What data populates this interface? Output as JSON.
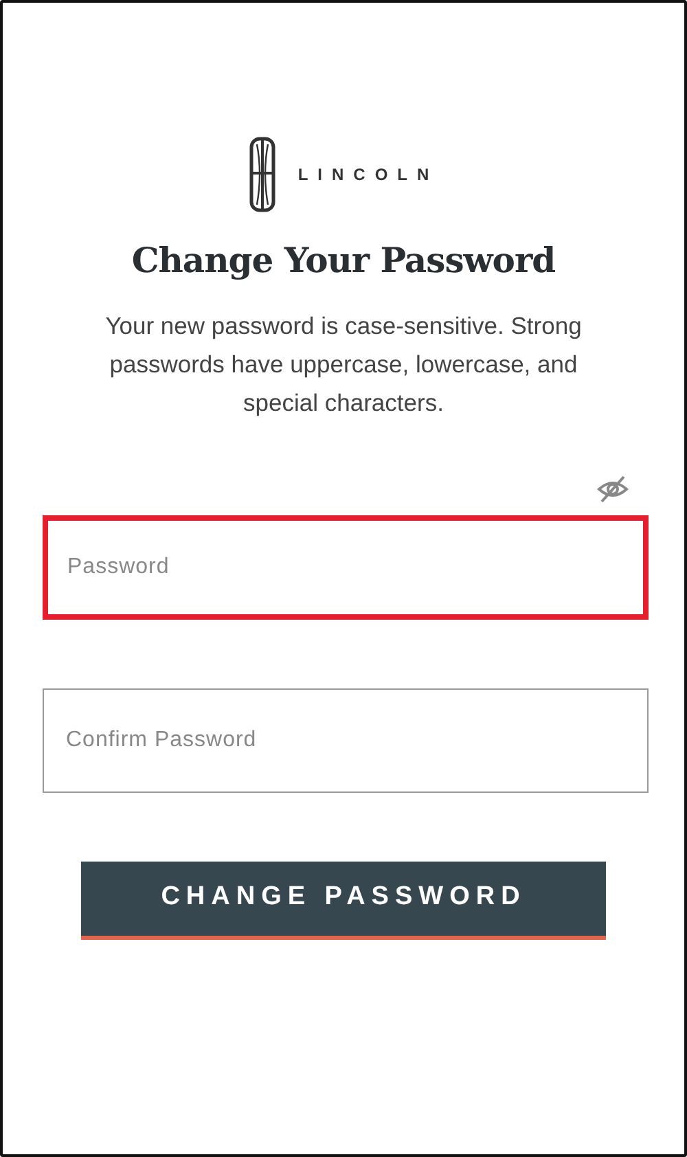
{
  "logo": {
    "wordmark": "LINCOLN"
  },
  "title": "Change Your Password",
  "description": "Your new password is case-sensitive. Strong passwords have uppercase, lowercase, and special characters.",
  "fields": [
    {
      "placeholder": "Password",
      "highlighted": true
    },
    {
      "placeholder": "Confirm Password",
      "highlighted": false
    }
  ],
  "button": {
    "label": "CHANGE PASSWORD"
  }
}
